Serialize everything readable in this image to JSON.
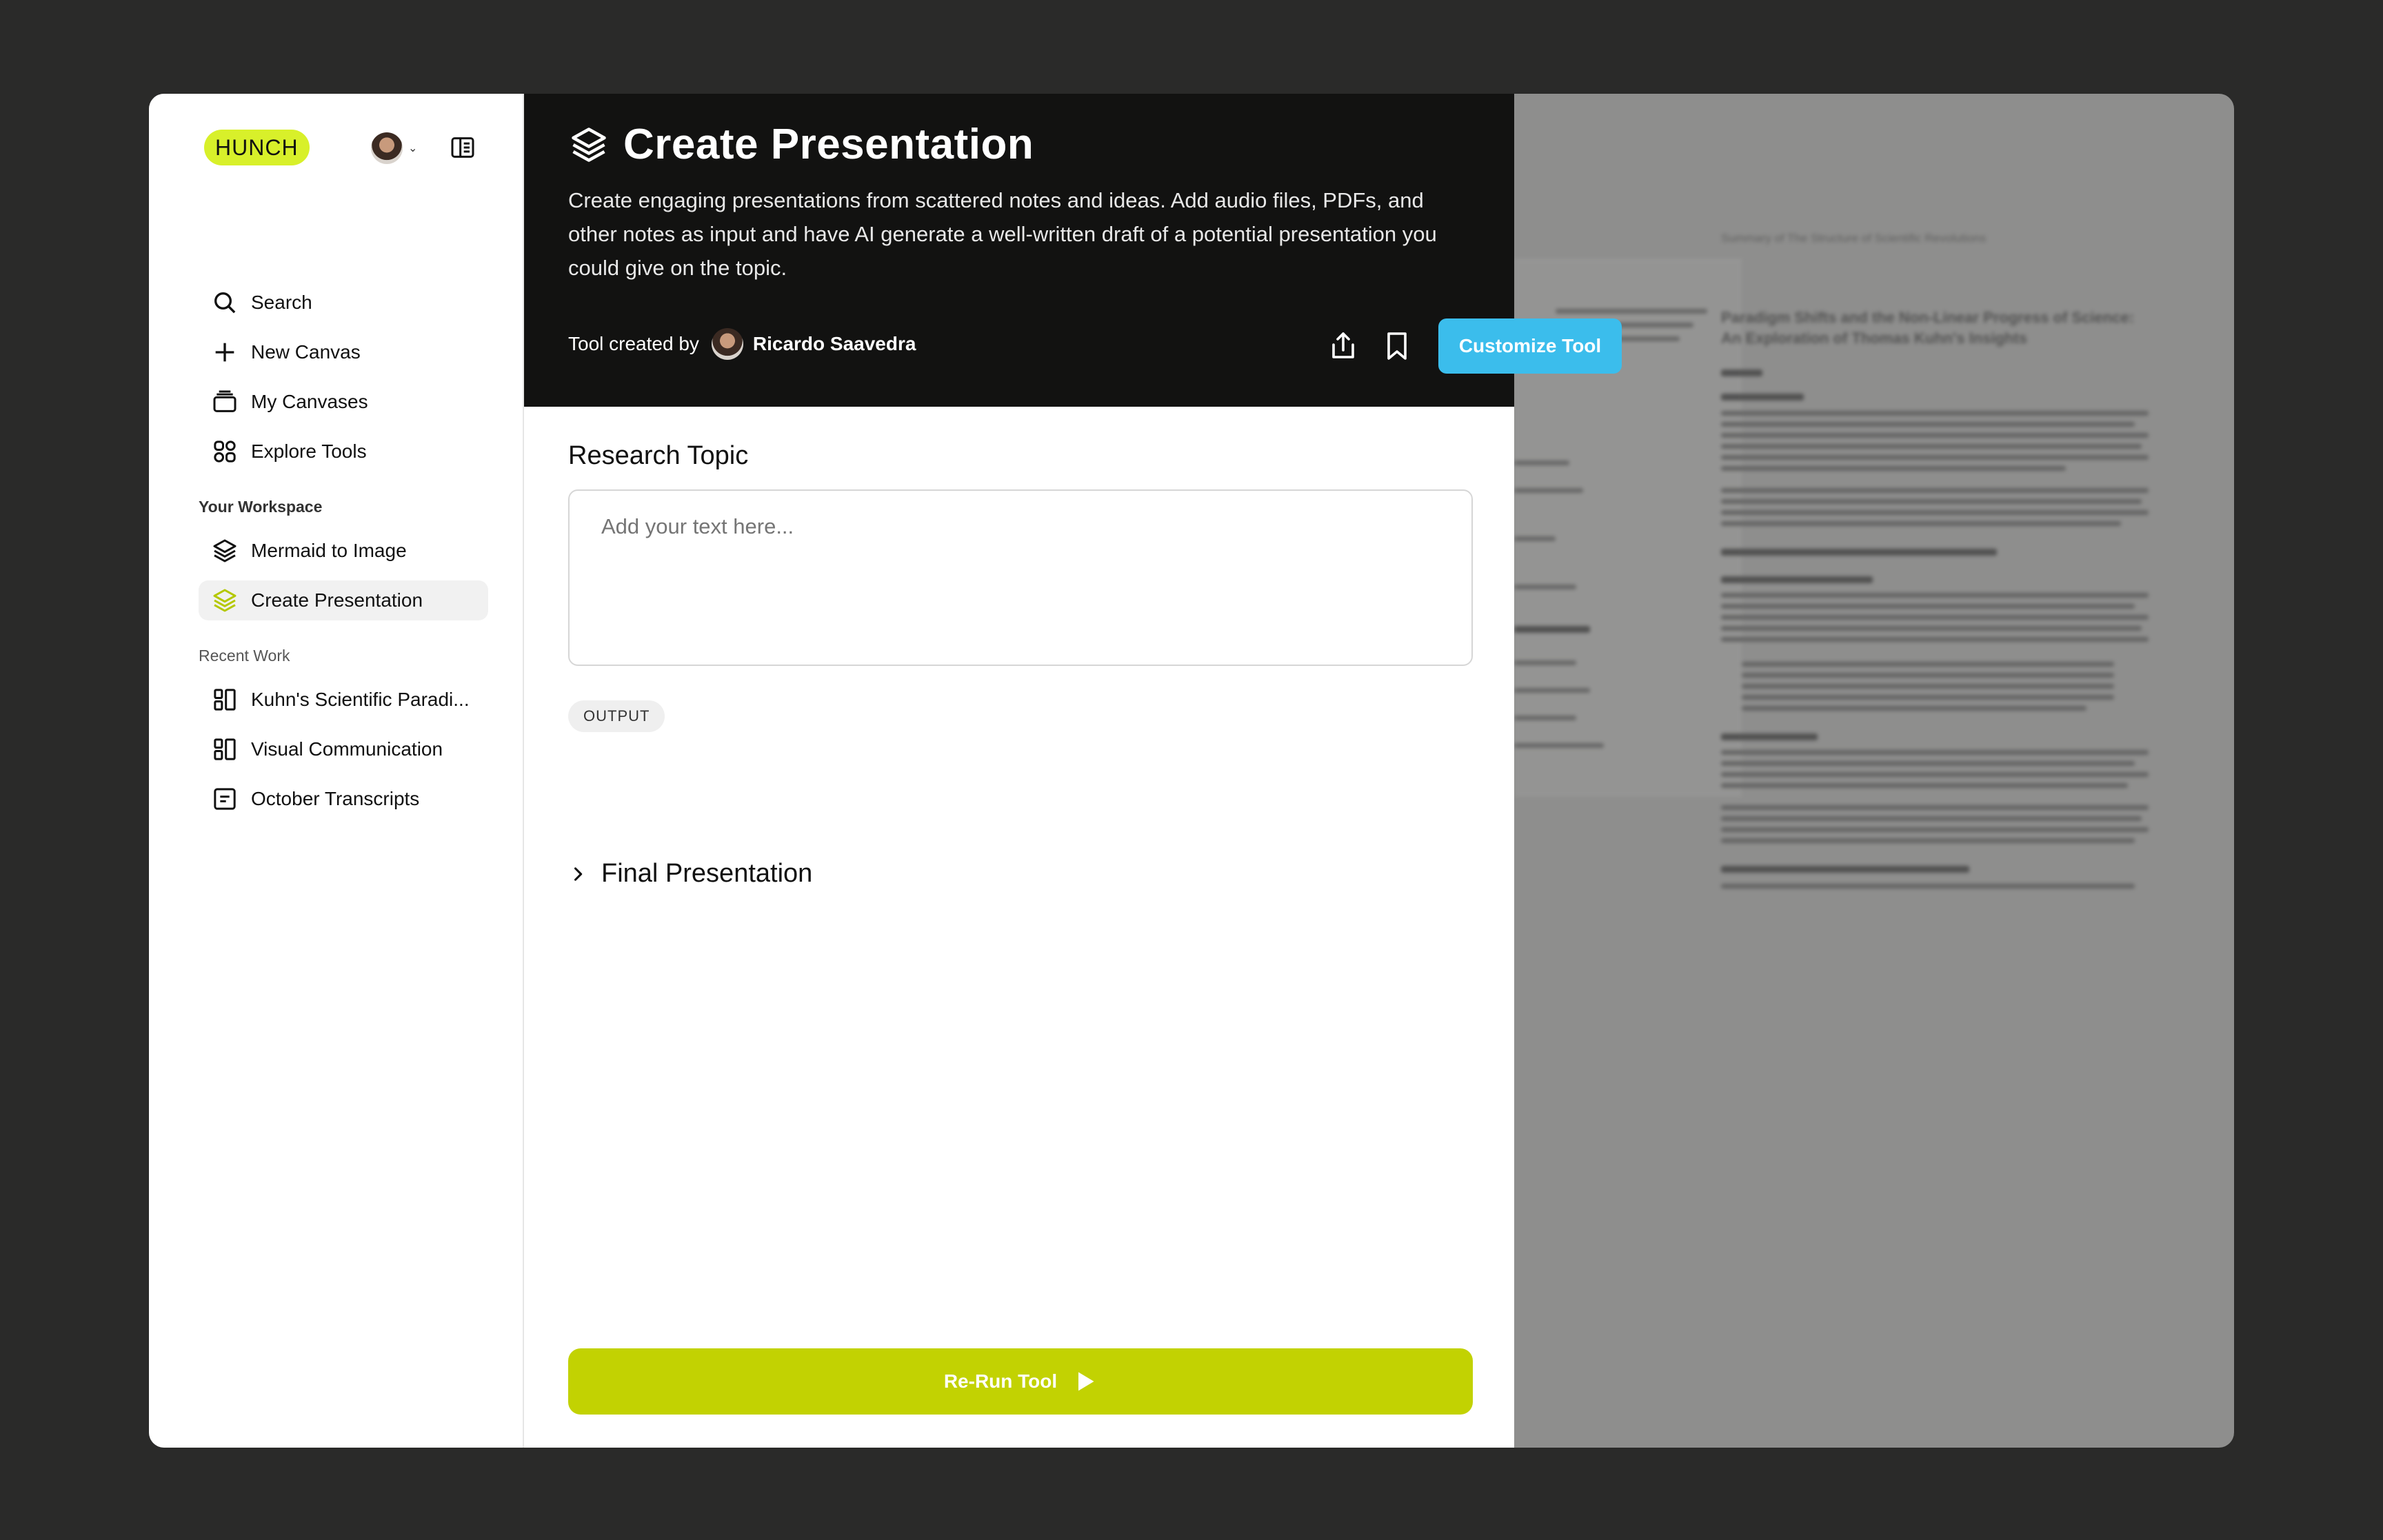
{
  "sidebar": {
    "logo": "HUNCH",
    "nav": [
      {
        "label": "Search"
      },
      {
        "label": "New Canvas"
      },
      {
        "label": "My Canvases"
      },
      {
        "label": "Explore Tools"
      }
    ],
    "workspace_label": "Your Workspace",
    "workspace_items": [
      {
        "label": "Mermaid to Image"
      },
      {
        "label": "Create Presentation",
        "active": true
      }
    ],
    "recent_label": "Recent Work",
    "recent_items": [
      {
        "label": "Kuhn's Scientific Paradi..."
      },
      {
        "label": "Visual Communication"
      },
      {
        "label": "October Transcripts"
      }
    ]
  },
  "tool": {
    "title": "Create Presentation",
    "description": "Create engaging presentations from scattered notes and ideas. Add audio files, PDFs, and other notes as input and have AI generate a well-written draft of a potential presentation you could give on the topic.",
    "created_by_label": "Tool created by",
    "creator_name": "Ricardo Saavedra",
    "customize_label": "Customize Tool"
  },
  "form": {
    "research_label": "Research Topic",
    "research_placeholder": "Add your text here...",
    "output_pill": "OUTPUT",
    "final_label": "Final Presentation",
    "rerun_label": "Re-Run Tool"
  },
  "background_doc": {
    "header": "Summary of The Structure of Scientific Revolutions",
    "title": "Paradigm Shifts and the Non-Linear Progress of Science: An Exploration of Thomas Kuhn's Insights"
  },
  "colors": {
    "logo_bg": "#d8f02a",
    "customize_bg": "#3bbdec",
    "rerun_bg": "#c2d202",
    "header_bg": "#121211"
  }
}
